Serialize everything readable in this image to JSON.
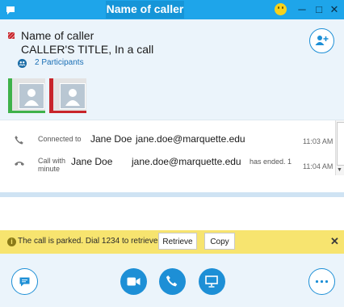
{
  "window": {
    "title": "Name of caller",
    "minimize_glyph": "─",
    "maximize_glyph": "□",
    "close_glyph": "✕"
  },
  "caller": {
    "name": "Name of caller",
    "title_status": "CALLER'S TITLE, In a call",
    "participants": "2 Participants"
  },
  "conversation": {
    "rows": [
      {
        "prefix": "Connected to",
        "name": "Jane Doe",
        "email": "jane.doe@marquette.edu",
        "suffix": "",
        "time": "11:03 AM",
        "icon": "phone-icon"
      },
      {
        "prefix_line1": "Call with",
        "prefix_line2": "minute",
        "name": "Jane Doe",
        "email": "jane.doe@marquette.edu",
        "suffix": "has ended. 1",
        "time": "11:04 AM",
        "icon": "hangup-icon"
      }
    ]
  },
  "notification": {
    "message": "The call is parked. Dial 1234 to retrieve.",
    "retrieve_label": "Retrieve",
    "copy_label": "Copy",
    "close_glyph": "✕"
  },
  "colors": {
    "accent": "#1d8fd6",
    "titlebar": "#1ea5ea",
    "notification": "#f7e46f",
    "busy": "#c8242a",
    "available": "#3fb24a"
  },
  "icons": [
    "app-icon",
    "emoji-icon",
    "add-participant-icon",
    "participants-icon",
    "phone-icon",
    "hangup-icon",
    "info-icon",
    "chat-icon",
    "video-icon",
    "call-icon",
    "screen-share-icon",
    "more-icon"
  ]
}
